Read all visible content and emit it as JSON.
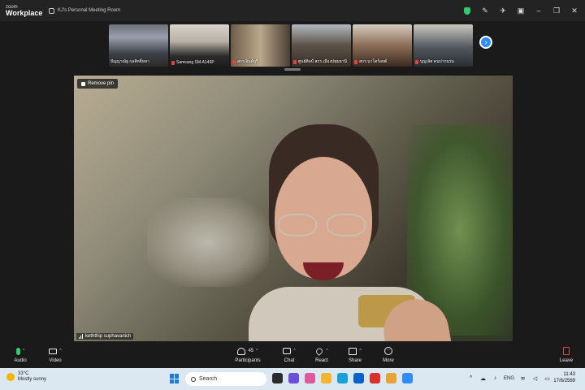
{
  "titlebar": {
    "brand_top": "zoom",
    "brand_bottom": "Workplace",
    "room": "KJ's Personal Meeting Room"
  },
  "participants_strip": [
    {
      "name": "ปัญญาณัฐ กุลสิทธิ์ทยา",
      "muted": false
    },
    {
      "name": "Samsung SM-A146P",
      "muted": true
    },
    {
      "name": "สกร.อินด์บุรี",
      "muted": true
    },
    {
      "name": "ศูนย์ศิลป์ สกร.เมืองปทุมธานี",
      "muted": true
    },
    {
      "name": "สกร.นาโตร้อยต์",
      "muted": true
    },
    {
      "name": "บุญเลิศ คนปากนร่ม",
      "muted": true
    }
  ],
  "stage": {
    "remove_pin": "Remove pin",
    "speaker_name": "keththip suphavanich"
  },
  "toolbar": {
    "audio": "Audio",
    "video": "Video",
    "participants": "Participants",
    "participants_count": "45",
    "chat": "Chat",
    "react": "React",
    "share": "Share",
    "more": "More",
    "leave": "Leave"
  },
  "taskbar": {
    "weather_temp": "33°C",
    "weather_desc": "Mostly sunny",
    "search": "Search",
    "lang": "ENG",
    "time": "11:43",
    "date": "17/6/2569"
  },
  "colors": {
    "accent": "#2d8cff",
    "mic_on": "#2ecc71",
    "muted": "#e0443e",
    "taskbar_bg": "#dbe7f1"
  }
}
